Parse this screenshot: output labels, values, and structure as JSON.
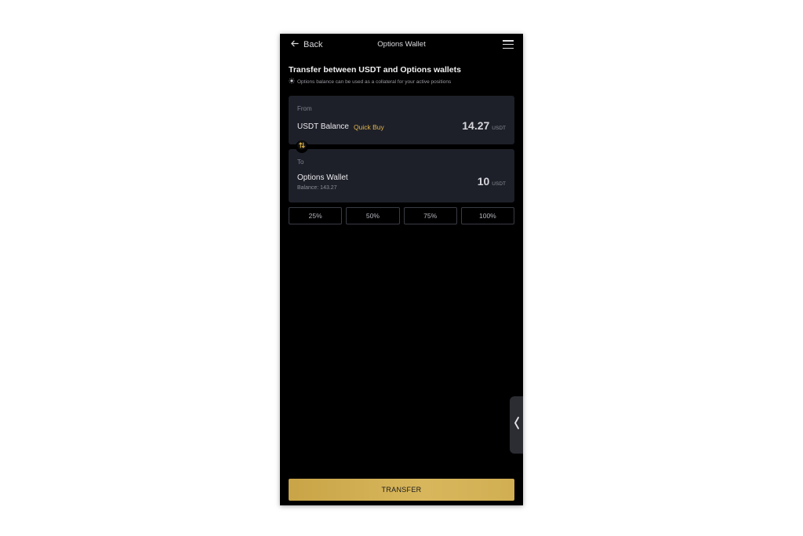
{
  "header": {
    "back_label": "Back",
    "title": "Options Wallet"
  },
  "intro": {
    "heading": "Transfer between USDT and Options wallets",
    "hint": "Options balance can be used as a collateral for your active positions"
  },
  "from_card": {
    "label": "From",
    "wallet_name": "USDT Balance",
    "quick_buy": "Quick Buy",
    "amount": "14.27",
    "unit": "USDT"
  },
  "to_card": {
    "label": "To",
    "wallet_name": "Options Wallet",
    "balance": "Balance: 143.27",
    "amount": "10",
    "unit": "USDT"
  },
  "percent_buttons": [
    "25%",
    "50%",
    "75%",
    "100%"
  ],
  "transfer_button": "TRANSFER",
  "icons": {
    "back": "arrow-left-icon",
    "menu": "hamburger-menu-icon",
    "hint": "lightbulb-icon",
    "swap": "swap-arrows-icon",
    "side_tab": "chevron-left-icon"
  },
  "colors": {
    "background": "#000000",
    "card": "#1e2029",
    "accent": "#e0b44a",
    "button": "#d3b054"
  }
}
